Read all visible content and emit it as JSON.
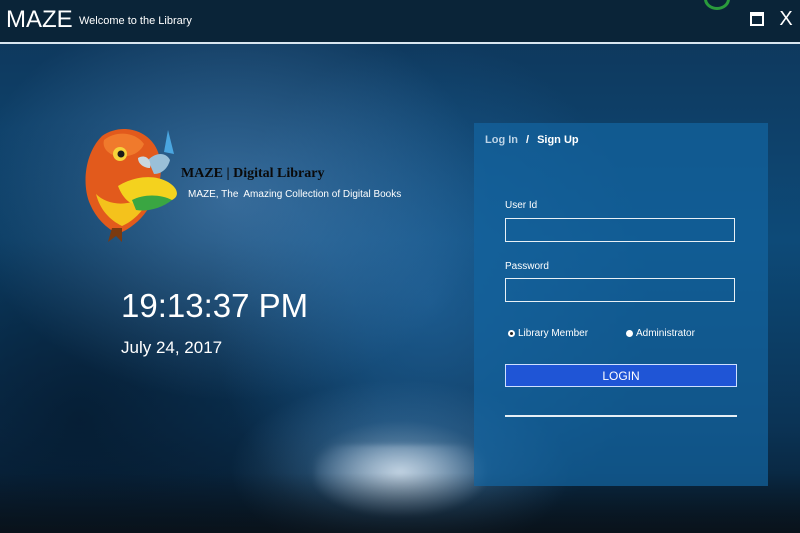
{
  "window": {
    "title": "MAZE",
    "subtitle": "Welcome to the Library"
  },
  "brand": {
    "title": "MAZE | Digital Library",
    "tagline": "MAZE, The  Amazing Collection of Digital Books"
  },
  "clock": {
    "time": "19:13:37 PM",
    "date": "July 24, 2017"
  },
  "auth": {
    "tabs": {
      "login": "Log In",
      "separator": "/",
      "signup": "Sign Up"
    },
    "user_id_label": "User Id",
    "user_id_value": "",
    "password_label": "Password",
    "password_value": "",
    "roles": [
      {
        "label": "Library Member",
        "selected": true
      },
      {
        "label": "Administrator",
        "selected": false
      }
    ],
    "login_label": "LOGIN"
  },
  "colors": {
    "titlebar": "#0a2438",
    "panel": "#1464a0",
    "login_button": "#1f55d6"
  }
}
